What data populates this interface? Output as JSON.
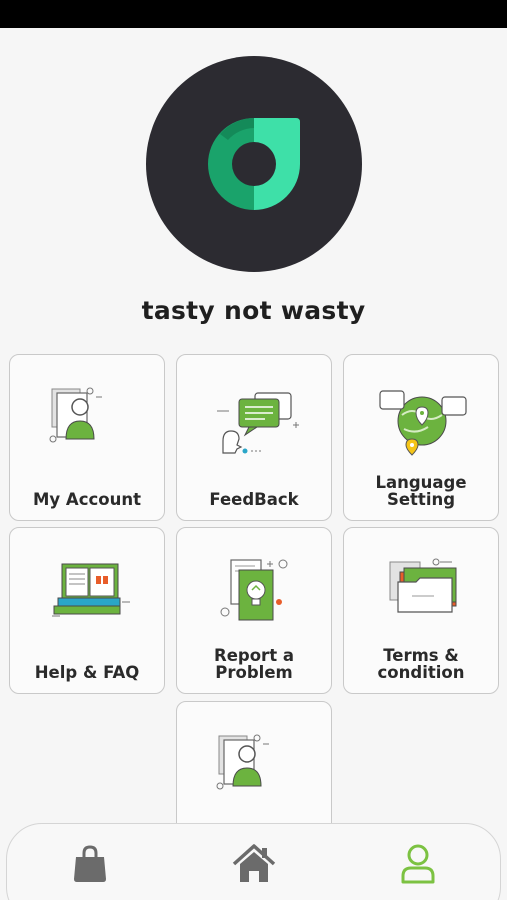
{
  "app": {
    "title": "tasty not wasty",
    "logo_icon": "tasty-not-wasty-logo"
  },
  "colors": {
    "accent_green": "#6cb33f",
    "logo_circle_bg": "#2c2b31",
    "logo_green_dark": "#1aa36b",
    "logo_green_light": "#3ee0a8",
    "nav_active": "#7cc242",
    "nav_inactive": "#6b6b6b"
  },
  "menu": {
    "items": [
      {
        "label": "My Account",
        "icon": "account-profile-icon"
      },
      {
        "label": "FeedBack",
        "icon": "feedback-chat-icon"
      },
      {
        "label": "Language\nSetting",
        "icon": "globe-language-icon"
      },
      {
        "label": "Help & FAQ",
        "icon": "books-help-icon"
      },
      {
        "label": "Report a\nProblem",
        "icon": "report-problem-icon"
      },
      {
        "label": "Terms &\ncondition",
        "icon": "folder-terms-icon"
      },
      {
        "label": "",
        "icon": "account-profile-icon"
      }
    ]
  },
  "bottom_nav": {
    "items": [
      {
        "icon": "shopping-bag-icon",
        "active": false
      },
      {
        "icon": "home-icon",
        "active": false
      },
      {
        "icon": "profile-icon",
        "active": true
      }
    ]
  }
}
